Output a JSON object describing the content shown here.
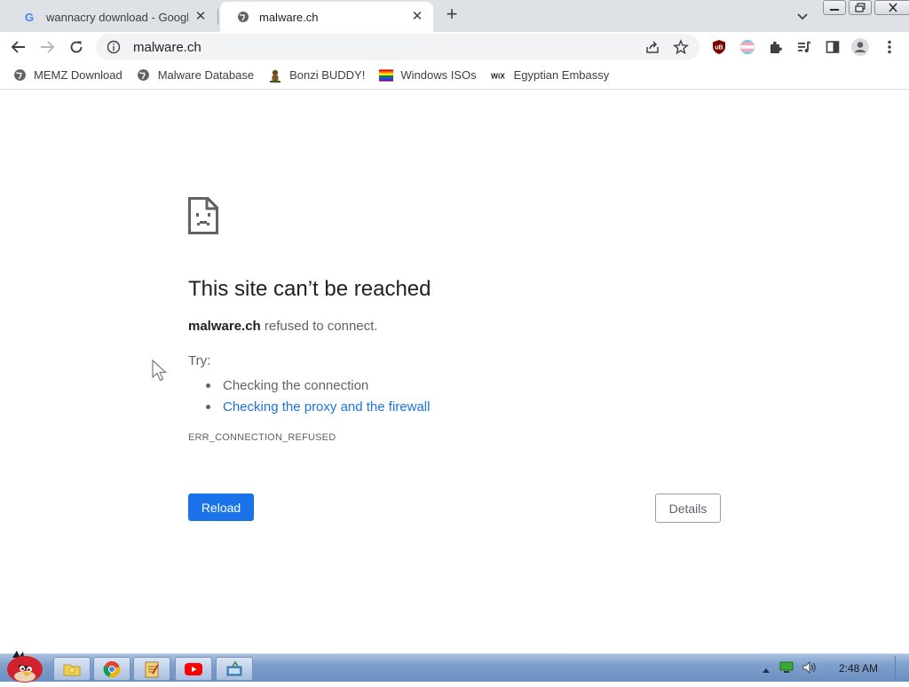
{
  "tabs": [
    {
      "title": "wannacry download - Google",
      "favicon": "google-icon",
      "active": false
    },
    {
      "title": "malware.ch",
      "favicon": "globe-icon",
      "active": true
    }
  ],
  "toolbar": {
    "url": "malware.ch"
  },
  "bookmarks": [
    {
      "label": "MEMZ Download",
      "icon": "globe-icon"
    },
    {
      "label": "Malware Database",
      "icon": "globe-icon"
    },
    {
      "label": "Bonzi BUDDY!",
      "icon": "bonzi-icon"
    },
    {
      "label": "Windows ISOs",
      "icon": "rainbow-flag-icon"
    },
    {
      "label": "Egyptian Embassy",
      "icon": "wix-icon"
    }
  ],
  "error": {
    "title": "This site can’t be reached",
    "host": "malware.ch",
    "message": " refused to connect.",
    "try_label": "Try:",
    "suggestions": [
      {
        "text": "Checking the connection",
        "link": false
      },
      {
        "text": "Checking the proxy and the firewall",
        "link": true
      }
    ],
    "code": "ERR_CONNECTION_REFUSED",
    "reload_label": "Reload",
    "details_label": "Details"
  },
  "taskbar": {
    "clock": "2:48 AM"
  },
  "colors": {
    "link": "#1a73e8",
    "primary_button": "#1a73e8",
    "tabstrip": "#dee1e6"
  }
}
